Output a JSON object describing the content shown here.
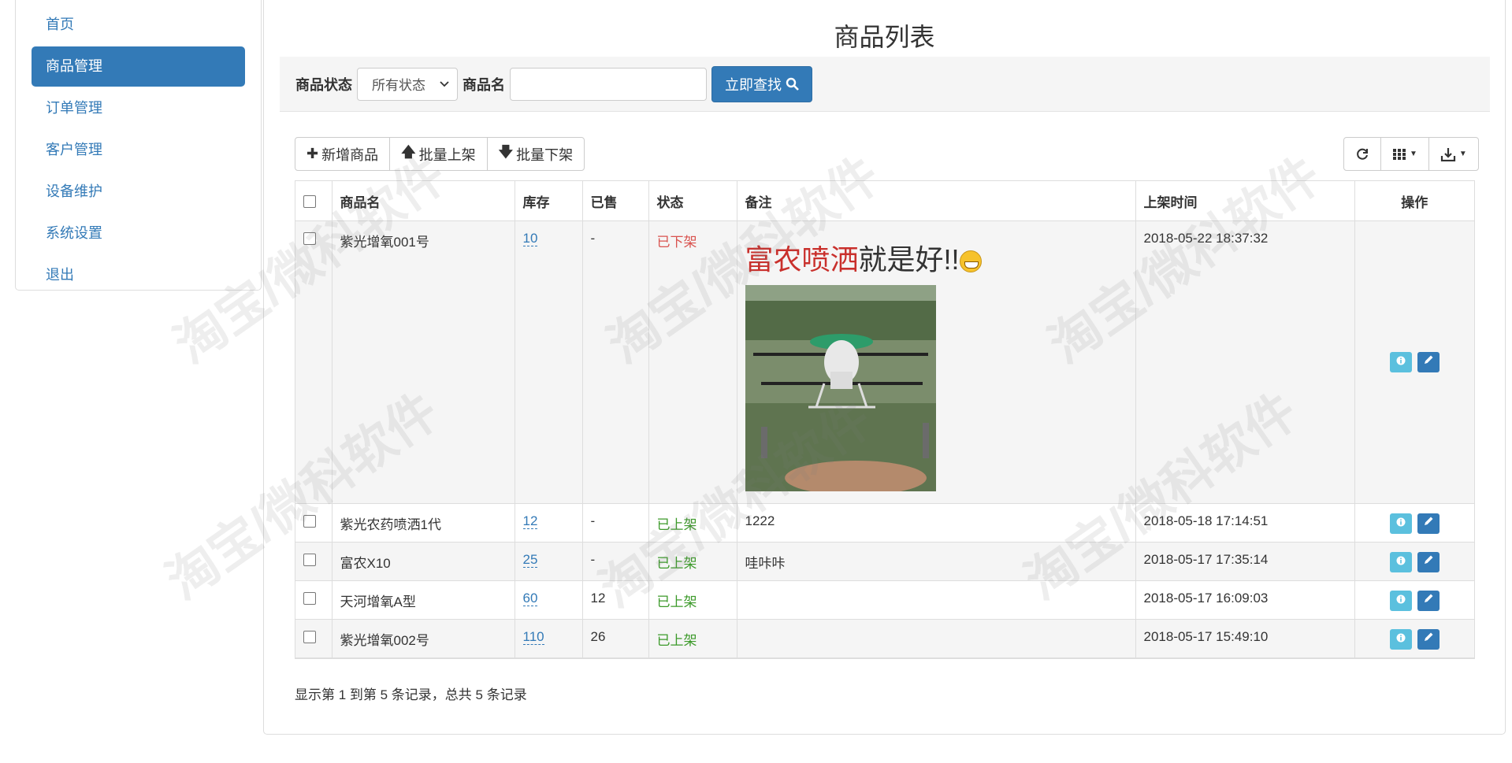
{
  "sidebar": {
    "items": [
      {
        "label": "首页"
      },
      {
        "label": "商品管理"
      },
      {
        "label": "订单管理"
      },
      {
        "label": "客户管理"
      },
      {
        "label": "设备维护"
      },
      {
        "label": "系统设置"
      },
      {
        "label": "退出"
      }
    ],
    "active_index": 1
  },
  "page": {
    "title": "商品列表"
  },
  "search": {
    "status_label": "商品状态",
    "status_value": "所有状态",
    "name_label": "商品名",
    "name_value": "",
    "submit_label": "立即查找"
  },
  "toolbar": {
    "add_label": "新增商品",
    "batch_on_label": "批量上架",
    "batch_off_label": "批量下架"
  },
  "table": {
    "headers": [
      "商品名",
      "库存",
      "已售",
      "状态",
      "备注",
      "上架时间",
      "操作"
    ],
    "rows": [
      {
        "name": "紫光增氧001号",
        "stock": "10",
        "sold": "-",
        "status": "已下架",
        "remark_red": "富农喷洒",
        "remark_black": "就是好!!",
        "time": "2018-05-22 18:37:32"
      },
      {
        "name": "紫光农药喷洒1代",
        "stock": "12",
        "sold": "-",
        "status": "已上架",
        "remark": "1222",
        "time": "2018-05-18 17:14:51"
      },
      {
        "name": "富农X10",
        "stock": "25",
        "sold": "-",
        "status": "已上架",
        "remark": "哇咔咔",
        "time": "2018-05-17 17:35:14"
      },
      {
        "name": "天河增氧A型",
        "stock": "60",
        "sold": "12",
        "status": "已上架",
        "remark": "",
        "time": "2018-05-17 16:09:03"
      },
      {
        "name": "紫光增氧002号",
        "stock": "110",
        "sold": "26",
        "status": "已上架",
        "remark": "",
        "time": "2018-05-17 15:49:10"
      }
    ]
  },
  "pagination": {
    "info": "显示第 1 到第 5 条记录，总共 5 条记录"
  },
  "watermark": "淘宝/微科软件",
  "colors": {
    "primary": "#337ab7",
    "info": "#5bc0de",
    "off": "#d9534f",
    "on": "#3c9a2a"
  }
}
